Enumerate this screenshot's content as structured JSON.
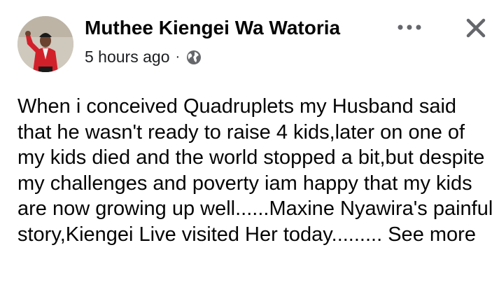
{
  "post": {
    "author": "Muthee Kiengei Wa Watoria",
    "timestamp": "5 hours ago",
    "separator": "·",
    "privacy_icon": "globe-icon",
    "more_icon": "more-options-icon",
    "close_icon": "close-icon",
    "body": "When i conceived Quadruplets my Husband said that he wasn't ready to raise 4 kids,later on one of my kids died and the world stopped a bit,but despite my challenges and poverty iam happy that my kids are now growing up well......Maxine Nyawira's painful story,Kiengei Live visited Her today.........",
    "see_more": "See more"
  },
  "colors": {
    "text": "#050505",
    "secondary": "#65676b",
    "avatar_jacket": "#d2202a"
  }
}
